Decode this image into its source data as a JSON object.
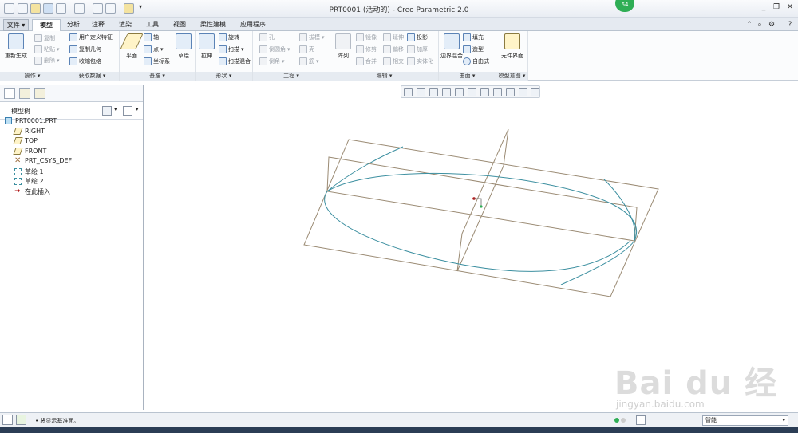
{
  "titlebar": {
    "title": "PRT0001 (活动的) - Creo Parametric 2.0",
    "badge": "64"
  },
  "tabs": [
    "文件",
    "模型",
    "分析",
    "注释",
    "渲染",
    "工具",
    "视图",
    "柔性建模",
    "应用程序"
  ],
  "ribbon": {
    "operations": {
      "label": "操作",
      "regen": "重新生成",
      "copy": "复制",
      "paste": "粘贴",
      "delete": "删除"
    },
    "get_data": {
      "label": "获取数据",
      "udf": "用户定义特征",
      "copy_geom": "复制几何",
      "shrinkwrap": "收缩包络"
    },
    "datum": {
      "label": "基准",
      "plane": "平面",
      "axis": "轴",
      "point": "点",
      "csys": "坐标系",
      "sketch": "草绘"
    },
    "shapes": {
      "label": "形状",
      "extrude": "拉伸",
      "revolve": "旋转",
      "sweep": "扫描",
      "swept_blend": "扫描混合"
    },
    "engineering": {
      "label": "工程",
      "hole": "孔",
      "round": "倒圆角",
      "chamfer": "倒角",
      "draft": "拔模",
      "shell": "壳",
      "rib": "筋"
    },
    "editing": {
      "label": "编辑",
      "pattern": "阵列",
      "mirror": "镜像",
      "trim": "修剪",
      "merge": "合并",
      "extend": "延伸",
      "offset": "偏移",
      "intersect": "相交",
      "project": "投影",
      "thicken": "加厚",
      "solidify": "实体化"
    },
    "surfaces": {
      "label": "曲面",
      "boundary_blend": "边界混合",
      "fill": "填充",
      "style": "造型",
      "freestyle": "自由式"
    },
    "model_intent": {
      "label": "模型意图",
      "component_interface": "元件界面"
    }
  },
  "model_tree": {
    "title": "模型树",
    "items": [
      "PRT0001.PRT",
      "RIGHT",
      "TOP",
      "FRONT",
      "PRT_CSYS_DEF",
      "草绘 1",
      "草绘 2",
      "在此插入"
    ]
  },
  "status": {
    "message": "• 将显示基准面。",
    "filter": "智能"
  },
  "watermark": {
    "main": "Bai du 经验",
    "url": "jingyan.baidu.com"
  },
  "colors": {
    "datum_plane": "#9b8b74",
    "sketch_curve": "#3c8fa0",
    "accent": "#2fae55",
    "insert_marker": "#b01818"
  }
}
